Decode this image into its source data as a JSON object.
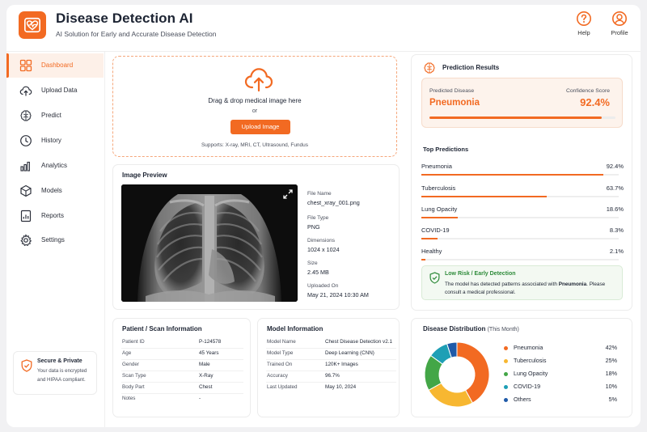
{
  "app": {
    "title": "Disease Detection AI",
    "subtitle": "AI Solution for Early and Accurate Disease Detection",
    "help_label": "Help",
    "profile_label": "Profile"
  },
  "sidebar": {
    "items": [
      {
        "label": "Dashboard",
        "icon": "dashboard-icon"
      },
      {
        "label": "Upload Data",
        "icon": "cloud-upload-icon"
      },
      {
        "label": "Predict",
        "icon": "brain-icon"
      },
      {
        "label": "History",
        "icon": "clock-icon"
      },
      {
        "label": "Analytics",
        "icon": "bar-chart-icon"
      },
      {
        "label": "Models",
        "icon": "cube-icon"
      },
      {
        "label": "Reports",
        "icon": "report-icon"
      },
      {
        "label": "Settings",
        "icon": "gear-icon"
      }
    ],
    "active_index": 0,
    "secure": {
      "title": "Secure & Private",
      "desc": "Your data is encrypted and HIPAA compliant."
    }
  },
  "upload": {
    "drag_text": "Drag & drop medical image here",
    "or_text": "or",
    "button_label": "Upload Image",
    "supports_text": "Supports: X-ray, MRI, CT, Ultrasound, Fundus"
  },
  "preview": {
    "title": "Image Preview",
    "meta": [
      {
        "label": "File Name",
        "value": "chest_xray_001.png"
      },
      {
        "label": "File Type",
        "value": "PNG"
      },
      {
        "label": "Dimensions",
        "value": "1024 x 1024"
      },
      {
        "label": "Size",
        "value": "2.45 MB"
      },
      {
        "label": "Uploaded On",
        "value": "May 21, 2024 10:30 AM"
      }
    ]
  },
  "prediction": {
    "title": "Prediction Results",
    "predicted_label": "Predicted Disease",
    "predicted_value": "Pneumonia",
    "confidence_label": "Confidence Score",
    "confidence_value": "92.4%",
    "confidence_fraction": 0.924,
    "top_title": "Top Predictions",
    "top": [
      {
        "name": "Pneumonia",
        "pct": "92.4%",
        "value": 92.4
      },
      {
        "name": "Tuberculosis",
        "pct": "63.7%",
        "value": 63.7
      },
      {
        "name": "Lung Opacity",
        "pct": "18.6%",
        "value": 18.6
      },
      {
        "name": "COVID-19",
        "pct": "8.3%",
        "value": 8.3
      },
      {
        "name": "Healthy",
        "pct": "2.1%",
        "value": 2.1
      }
    ],
    "risk_title": "Low Risk / Early Detection",
    "risk_desc_1": "The model has detected patterns associated with ",
    "risk_desc_bold": "Pneumonia",
    "risk_desc_2": ". Please consult a medical professional."
  },
  "patient": {
    "title": "Patient / Scan Information",
    "rows": [
      {
        "key": "Patient ID",
        "value": "P-124578"
      },
      {
        "key": "Age",
        "value": "45 Years"
      },
      {
        "key": "Gender",
        "value": "Male"
      },
      {
        "key": "Scan Type",
        "value": "X-Ray"
      },
      {
        "key": "Body Part",
        "value": "Chest"
      },
      {
        "key": "Notes",
        "value": "-"
      }
    ]
  },
  "model": {
    "title": "Model Information",
    "rows": [
      {
        "key": "Model Name",
        "value": "Chest Disease Detection v2.1"
      },
      {
        "key": "Model Type",
        "value": "Deep Learning (CNN)"
      },
      {
        "key": "Trained On",
        "value": "120K+ Images"
      },
      {
        "key": "Accuracy",
        "value": "96.7%"
      },
      {
        "key": "Last Updated",
        "value": "May 10, 2024"
      }
    ]
  },
  "distribution": {
    "title": "Disease Distribution",
    "period": "(This Month)"
  },
  "colors": {
    "accent": "#f26a22",
    "pneumonia": "#f26a22",
    "tuberculosis": "#f7b731",
    "lung_opacity": "#43a647",
    "covid": "#1e9fb5",
    "others": "#1f5aa8"
  },
  "chart_data": {
    "type": "pie",
    "title": "Disease Distribution",
    "categories": [
      "Pneumonia",
      "Tuberculosis",
      "Lung Opacity",
      "COVID-19",
      "Others"
    ],
    "values": [
      42,
      25,
      18,
      10,
      5
    ],
    "labels": [
      "42%",
      "25%",
      "18%",
      "10%",
      "5%"
    ],
    "colors": [
      "#f26a22",
      "#f7b731",
      "#43a647",
      "#1e9fb5",
      "#1f5aa8"
    ],
    "legend": "right"
  }
}
